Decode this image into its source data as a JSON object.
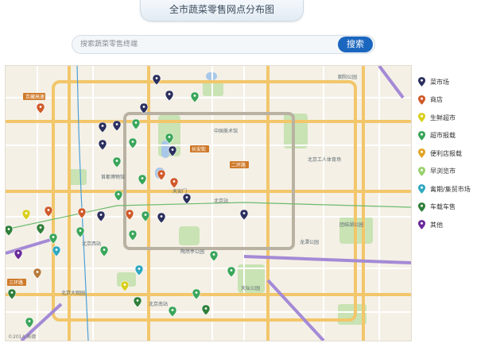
{
  "page": {
    "title": "全市蔬菜零售网点分布图"
  },
  "search": {
    "placeholder": "搜索蔬菜零售终端",
    "button_label": "搜索"
  },
  "legend": [
    {
      "label": "菜市场",
      "color": "#2b2f5e"
    },
    {
      "label": "商店",
      "color": "#d05a2a"
    },
    {
      "label": "生鲜超市",
      "color": "#d9cf1f"
    },
    {
      "label": "超市报载",
      "color": "#3aa65a"
    },
    {
      "label": "便利店报载",
      "color": "#e0a526"
    },
    {
      "label": "早浏览市",
      "color": "#9bd16d"
    },
    {
      "label": "禽期/集贸市场",
      "color": "#2fa8c0"
    },
    {
      "label": "车载车售",
      "color": "#2f7f3a"
    },
    {
      "label": "其他",
      "color": "#6b2a9a"
    }
  ],
  "map_labels": [
    "北京西站",
    "北京站",
    "天安门",
    "天坛公园",
    "中国美术馆",
    "北京南站",
    "朝阳公园",
    "龙潭公园",
    "团结湖公园",
    "北京工人体育场",
    "陶然亭公园",
    "北京大观园",
    "首都博物馆"
  ],
  "road_tags": [
    "京藏高速",
    "长安街",
    "二环路",
    "三环路"
  ],
  "footer": "©2014 高德"
}
